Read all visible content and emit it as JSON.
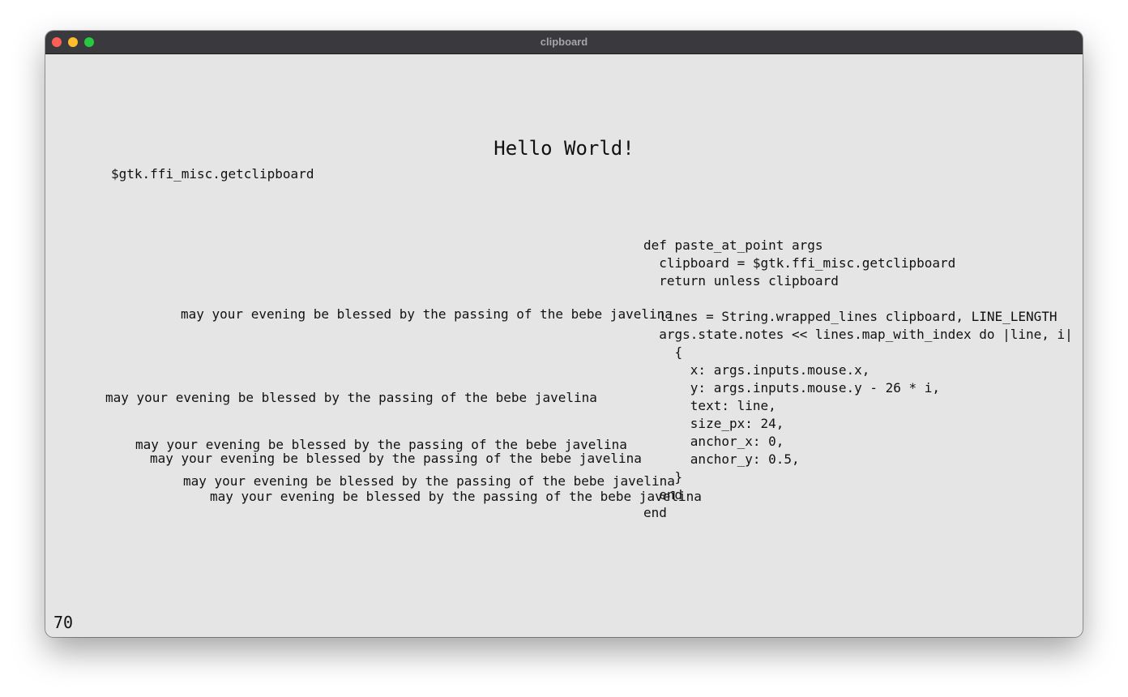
{
  "window": {
    "title": "clipboard"
  },
  "canvas": {
    "heading": "Hello World!",
    "clipboard_label": "$gtk.ffi_misc.getclipboard",
    "notes": [
      "may your evening be blessed by the passing of the bebe javelina",
      "may your evening be blessed by the passing of the bebe javelina",
      "may your evening be blessed by the passing of the bebe javelina",
      "may your evening be blessed by the passing of the bebe javelina",
      "may your evening be blessed by the passing of the bebe javelina",
      "may your evening be blessed by the passing of the bebe javelina"
    ],
    "code_lines": [
      "def paste_at_point args",
      "  clipboard = $gtk.ffi_misc.getclipboard",
      "  return unless clipboard",
      "",
      "  lines = String.wrapped_lines clipboard, LINE_LENGTH",
      "  args.state.notes << lines.map_with_index do |line, i|",
      "    {",
      "      x: args.inputs.mouse.x,",
      "      y: args.inputs.mouse.y - 26 * i,",
      "      text: line,",
      "      size_px: 24,",
      "      anchor_x: 0,",
      "      anchor_y: 0.5,",
      "    }",
      "  end",
      "end"
    ],
    "fps": "70"
  }
}
